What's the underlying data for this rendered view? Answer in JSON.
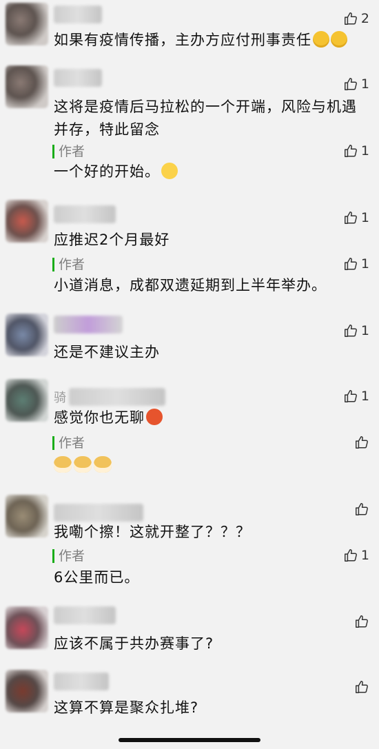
{
  "comments": [
    {
      "text": "如果有疫情传播，主办方应付刑事责任",
      "likes": "2",
      "emoji": "smirk-smirk"
    },
    {
      "text": "这将是疫情后马拉松的一个开端，风险与机遇并存，特此留念",
      "likes": "1",
      "reply": {
        "label": "作者",
        "text": "一个好的开始。",
        "likes": "1"
      }
    },
    {
      "text": "应推迟2个月最好",
      "likes": "1",
      "reply": {
        "label": "作者",
        "text": "小道消息，成都双遗延期到上半年举办。",
        "likes": "1"
      }
    },
    {
      "text": "还是不建议主办",
      "likes": "1"
    },
    {
      "nick": "骑",
      "text": "感觉你也无聊",
      "likes": "1",
      "reply": {
        "label": "作者",
        "text": "",
        "likes": ""
      }
    },
    {
      "text": "我嘞个擦！这就开整了？？？",
      "likes": "",
      "reply": {
        "label": "作者",
        "text": "6公里而已。",
        "likes": "1"
      }
    },
    {
      "text": "应该不属于共办赛事了?",
      "likes": ""
    },
    {
      "text": "这算不算是聚众扎堆?",
      "likes": ""
    }
  ]
}
